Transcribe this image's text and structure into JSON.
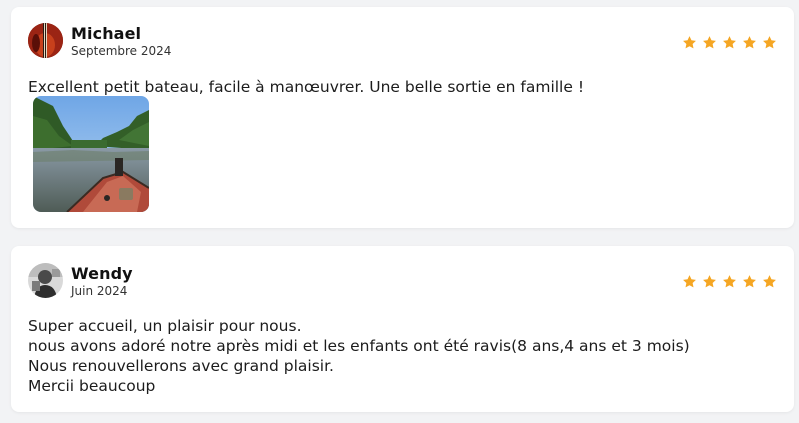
{
  "reviews": [
    {
      "author": "Michael",
      "date": "Septembre 2024",
      "rating": 5,
      "text_lines": [
        "Excellent petit bateau, facile à manœuvrer. Une belle sortie en famille !"
      ],
      "has_photo": true,
      "photo_subject": "boat bow on river with trees"
    },
    {
      "author": "Wendy",
      "date": "Juin 2024",
      "rating": 5,
      "text_lines": [
        "Super accueil, un plaisir pour nous.",
        "nous avons adoré notre après midi et les enfants ont été ravis(8 ans,4 ans et 3 mois)",
        "Nous renouvellerons avec grand plaisir.",
        "Mercii beaucoup"
      ],
      "has_photo": false
    }
  ],
  "colors": {
    "star": "#f5a623",
    "card_bg": "#ffffff",
    "page_bg": "#f2f3f5"
  },
  "icons": {
    "rating": "star-icon"
  }
}
